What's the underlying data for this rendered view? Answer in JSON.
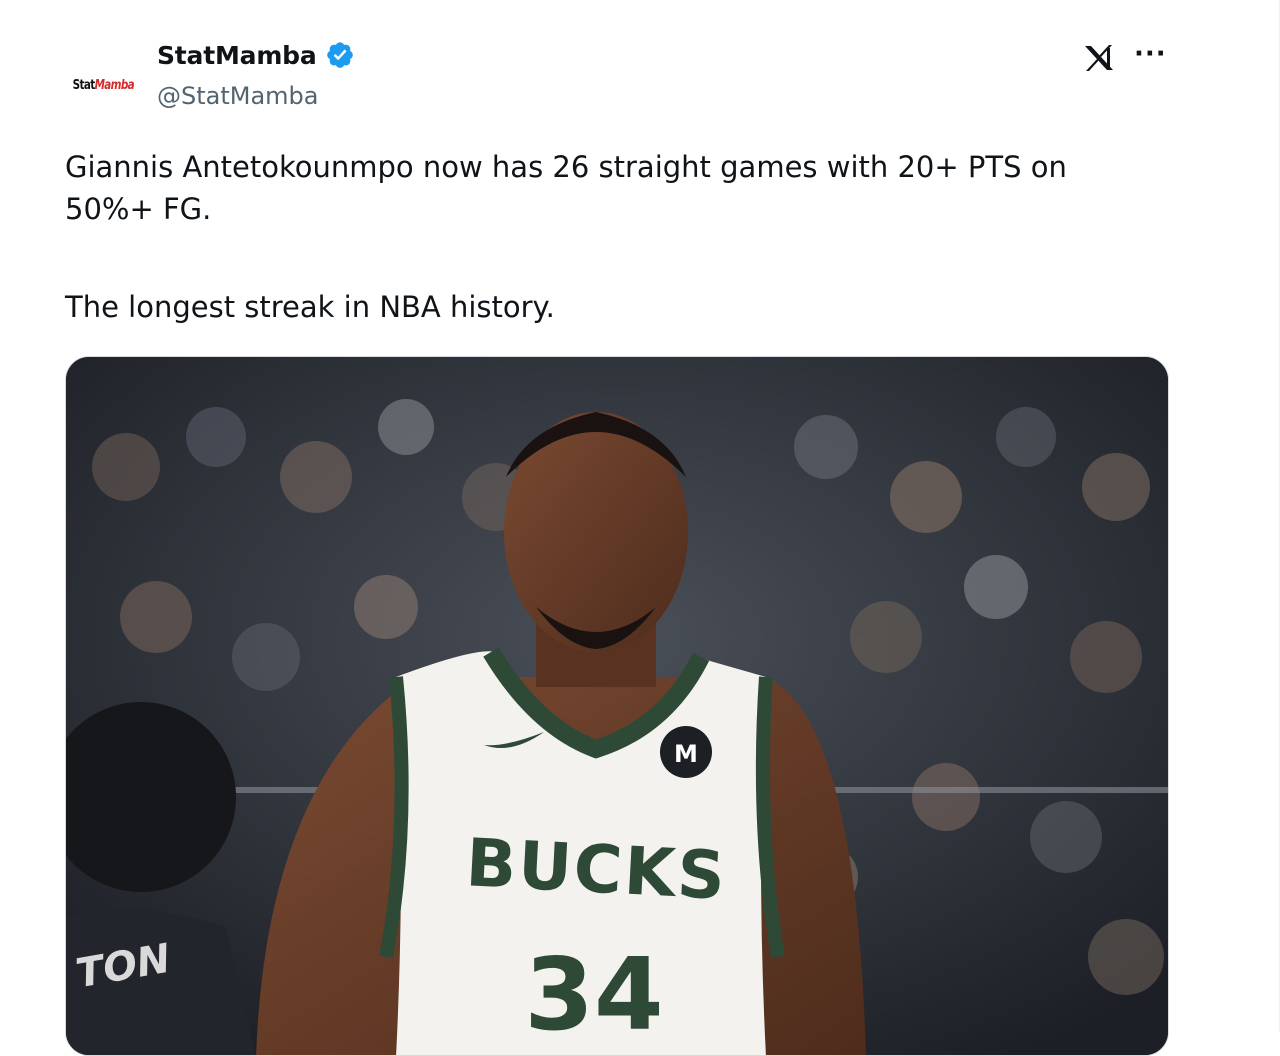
{
  "tweet": {
    "author": {
      "display_name": "StatMamba",
      "handle": "@StatMamba",
      "verified": true,
      "avatar_text_primary": "Stat",
      "avatar_text_accent": "Mamba"
    },
    "text_line1": "Giannis Antetokounmpo now has 26 straight games with 20+ PTS on 50%+ FG.",
    "text_line2": "The longest streak in NBA history.",
    "media": {
      "jersey_text": "BUCKS",
      "jersey_number": "34",
      "opponent_jersey_text": "TON"
    }
  },
  "icons": {
    "verified": "verified-badge-icon",
    "brand": "x-logo-icon",
    "more": "more-options-icon"
  },
  "colors": {
    "verified_blue": "#1d9bf0",
    "handle_gray": "#536471",
    "jersey_green": "#2e4a36"
  }
}
